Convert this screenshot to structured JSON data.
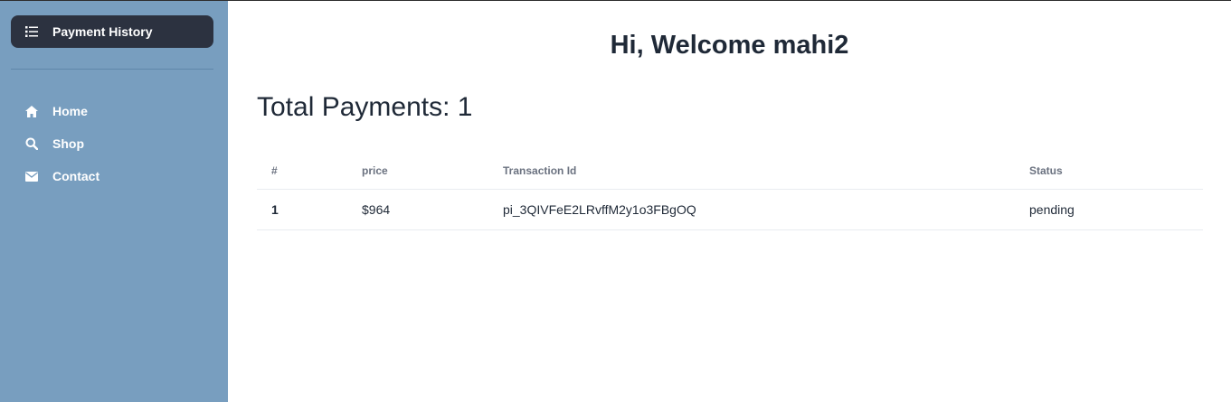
{
  "sidebar": {
    "active_item": {
      "label": "Payment History",
      "icon": "list-icon"
    },
    "items": [
      {
        "label": "Home",
        "icon": "home-icon"
      },
      {
        "label": "Shop",
        "icon": "search-icon"
      },
      {
        "label": "Contact",
        "icon": "envelope-icon"
      }
    ]
  },
  "main": {
    "welcome": "Hi, Welcome mahi2",
    "total_payments": "Total Payments: 1",
    "table": {
      "headers": [
        "#",
        "price",
        "Transaction Id",
        "Status"
      ],
      "rows": [
        {
          "index": "1",
          "price": "$964",
          "transaction_id": "pi_3QIVFeE2LRvffM2y1o3FBgOQ",
          "status": "pending"
        }
      ]
    }
  },
  "colors": {
    "sidebar_bg": "#789ebf",
    "active_item_bg": "#2c3240",
    "text": "#1f2937",
    "header_text": "#6b7280"
  }
}
